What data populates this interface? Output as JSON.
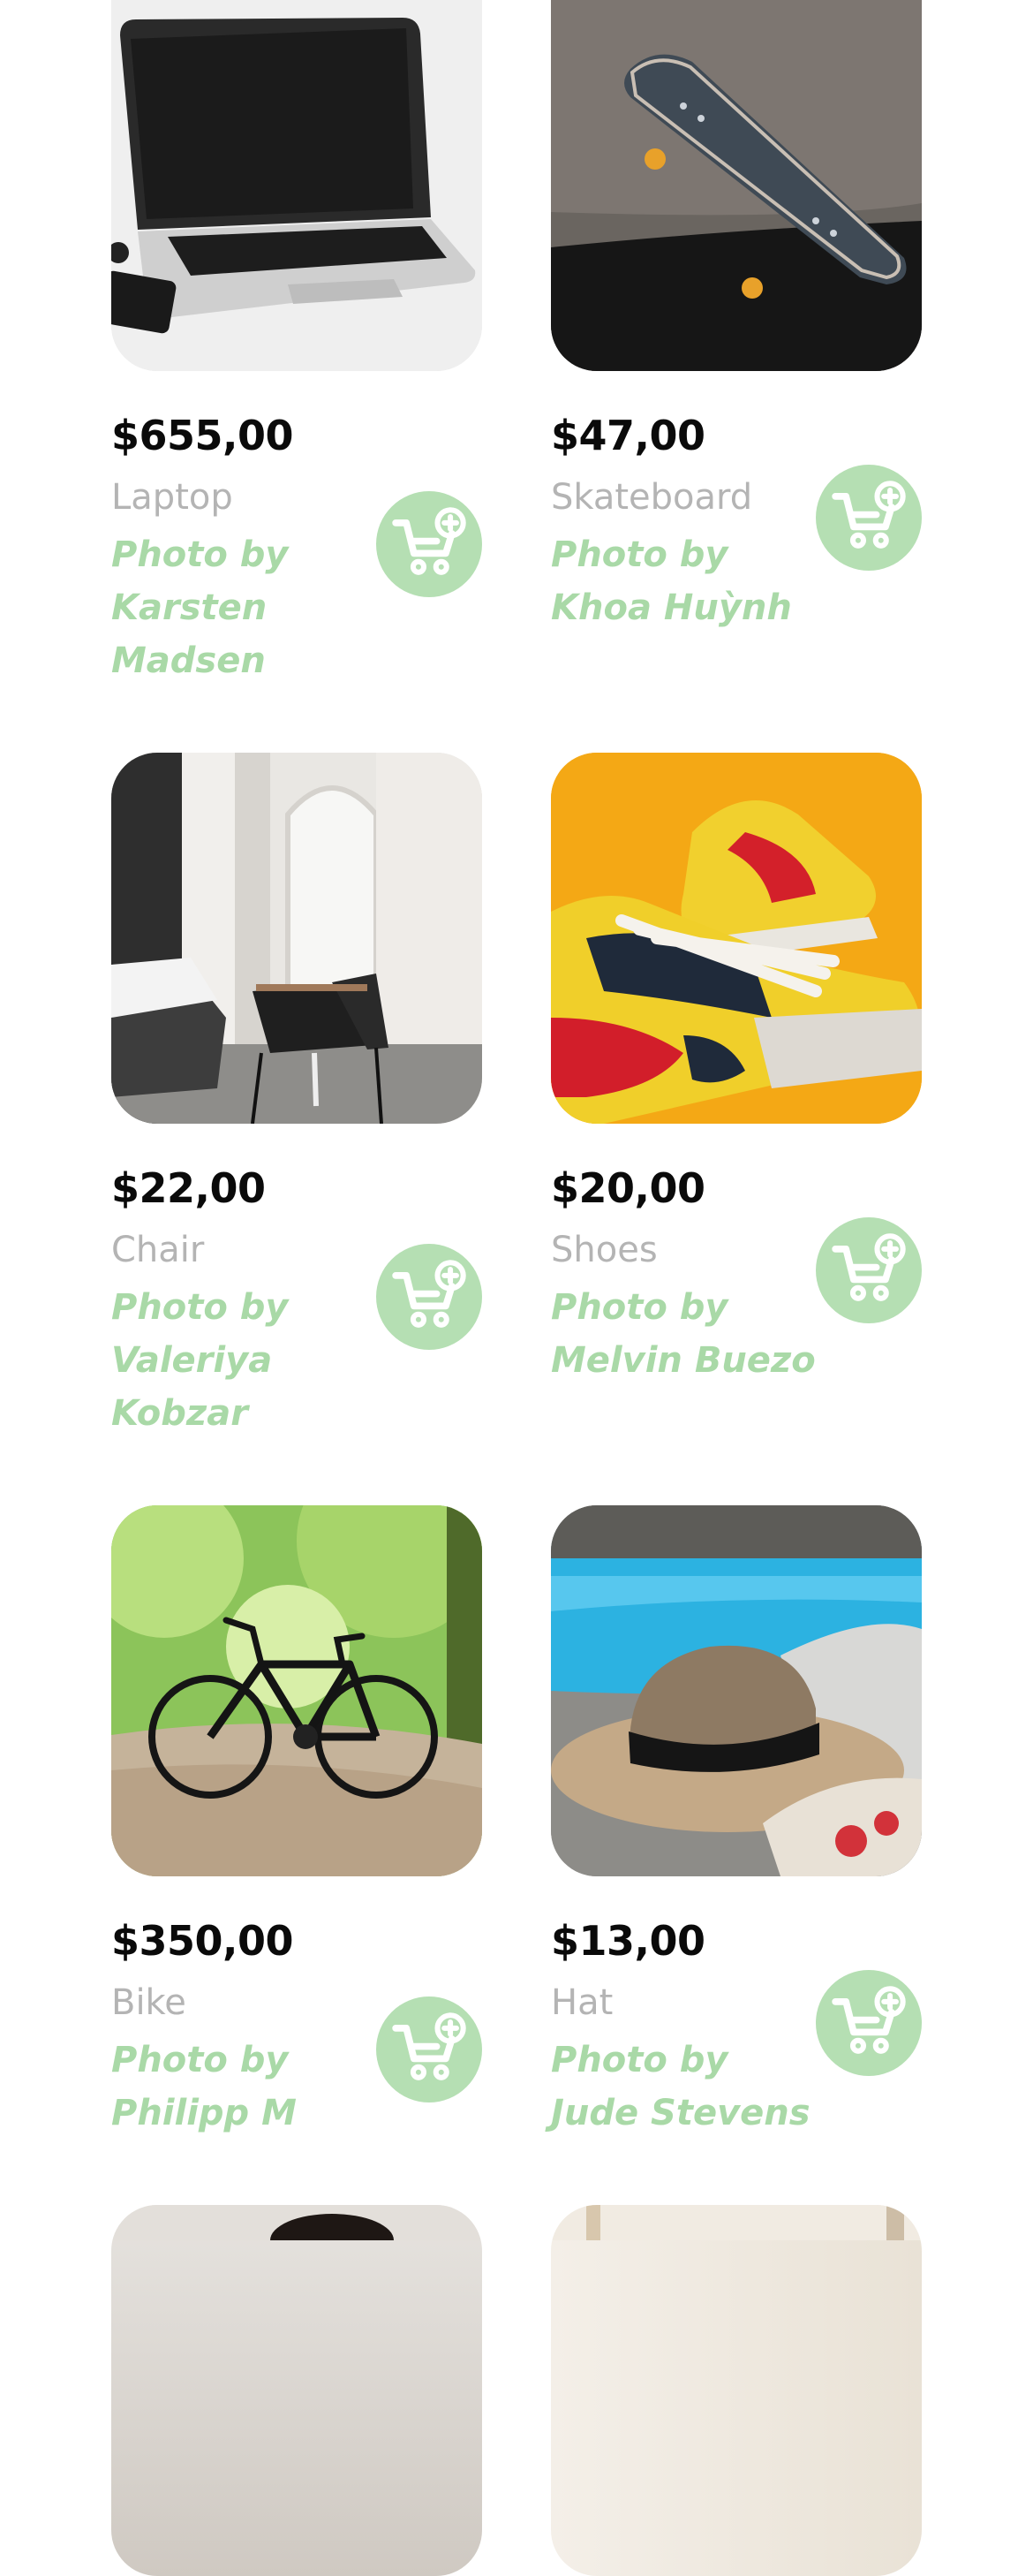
{
  "products": [
    {
      "price": "$655,00",
      "name": "Laptop",
      "credit": "Photo by Karsten Madsen",
      "photo_icon": "laptop-photo"
    },
    {
      "price": "$47,00",
      "name": "Skateboard",
      "credit": "Photo by Khoa Huỳnh",
      "photo_icon": "skateboard-photo"
    },
    {
      "price": "$22,00",
      "name": "Chair",
      "credit": "Photo by Valeriya Kobzar",
      "photo_icon": "chair-photo"
    },
    {
      "price": "$20,00",
      "name": "Shoes",
      "credit": "Photo by Melvin Buezo",
      "photo_icon": "shoes-photo"
    },
    {
      "price": "$350,00",
      "name": "Bike",
      "credit": "Photo by Philipp M",
      "photo_icon": "bike-photo"
    },
    {
      "price": "$13,00",
      "name": "Hat",
      "credit": "Photo by Jude Stevens",
      "photo_icon": "hat-photo"
    }
  ],
  "colors": {
    "accent_green": "#b5dfb3",
    "credit_green": "#a9d9a7",
    "muted_gray": "#b4b4b4",
    "price_black": "#0a0a0a"
  },
  "icons": {
    "cart_add": "cart-plus-icon"
  }
}
